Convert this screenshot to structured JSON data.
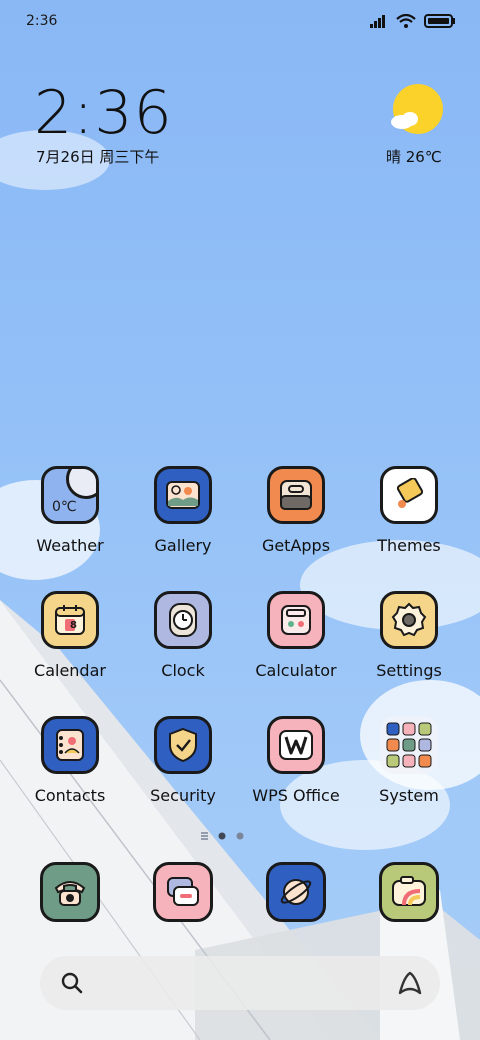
{
  "status": {
    "time": "2:36"
  },
  "lock": {
    "time": "2:36",
    "date": "7月26日 周三下午"
  },
  "weather": {
    "text": "晴 26℃"
  },
  "apps": [
    {
      "name": "weather",
      "label": "Weather",
      "bg": "#8fb3ee",
      "icon_text": "0℃"
    },
    {
      "name": "gallery",
      "label": "Gallery",
      "bg": "#2f5fc0"
    },
    {
      "name": "getapps",
      "label": "GetApps",
      "bg": "#f08a4e"
    },
    {
      "name": "themes",
      "label": "Themes",
      "bg": "#ffffff"
    },
    {
      "name": "calendar",
      "label": "Calendar",
      "bg": "#f4d58a",
      "icon_text": "8"
    },
    {
      "name": "clock",
      "label": "Clock",
      "bg": "#aeb8e0"
    },
    {
      "name": "calculator",
      "label": "Calculator",
      "bg": "#f6b3bb"
    },
    {
      "name": "settings",
      "label": "Settings",
      "bg": "#f4d58a"
    },
    {
      "name": "contacts",
      "label": "Contacts",
      "bg": "#2f5fc0"
    },
    {
      "name": "security",
      "label": "Security",
      "bg": "#2f5fc0"
    },
    {
      "name": "wps",
      "label": "WPS Office",
      "bg": "#f6b3bb"
    },
    {
      "name": "system",
      "label": "System",
      "bg": "#f2f2f6"
    }
  ],
  "dock": [
    {
      "name": "phone",
      "bg": "#6f9c86"
    },
    {
      "name": "messages",
      "bg": "#f6b3bb"
    },
    {
      "name": "browser",
      "bg": "#2f5fc0"
    },
    {
      "name": "camera",
      "bg": "#b8c97a"
    }
  ],
  "colors": {
    "wallpaper": "#8ab8f5",
    "outline": "#1a1a1a"
  }
}
